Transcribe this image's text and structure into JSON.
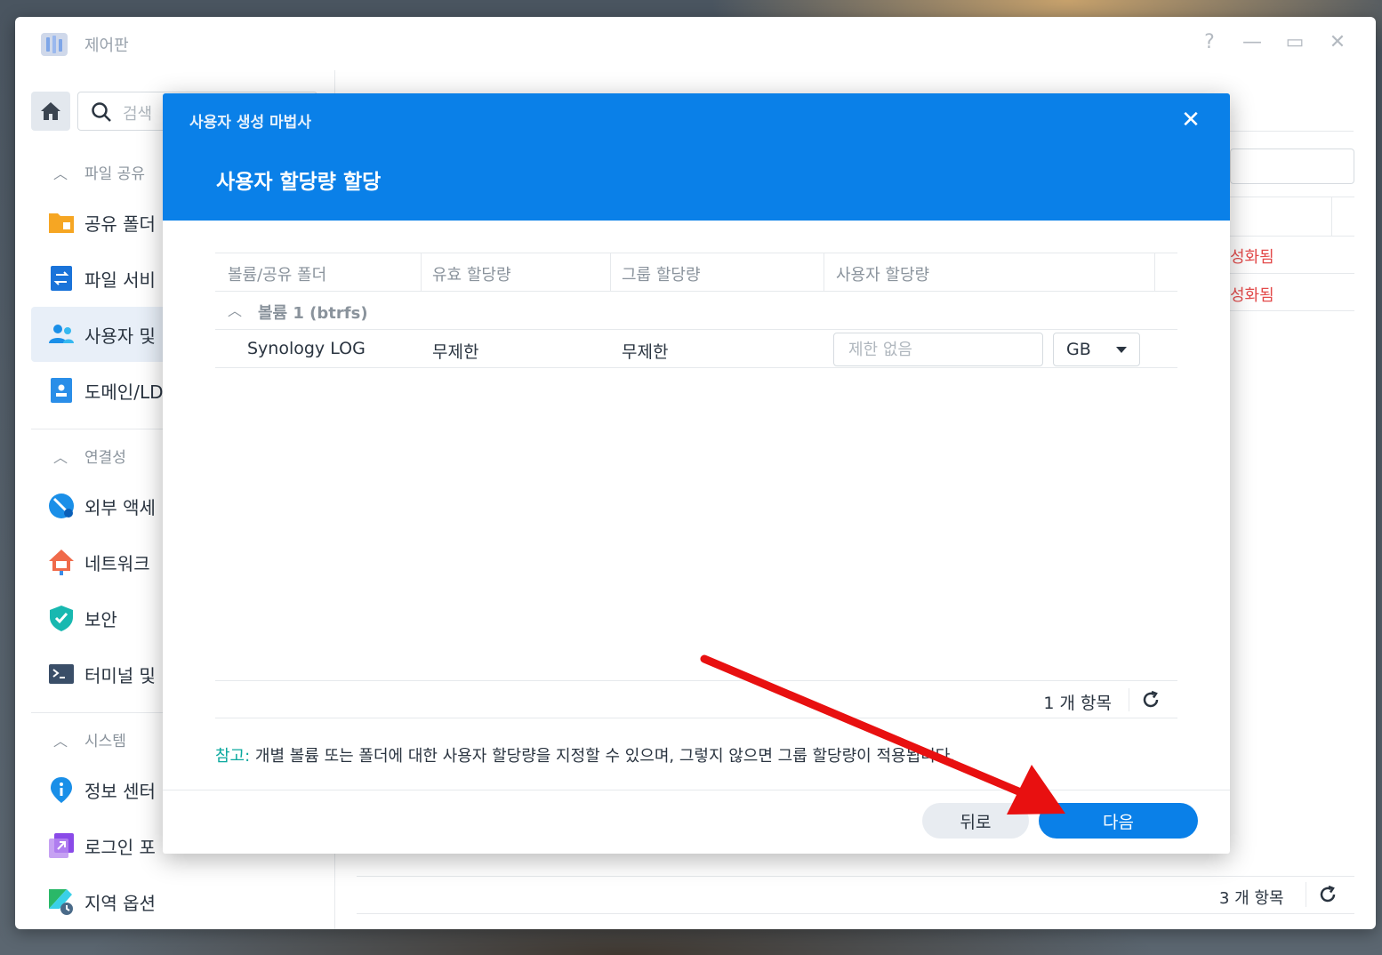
{
  "window": {
    "title": "제어판",
    "controls": [
      "?",
      "—",
      "▭",
      "✕"
    ]
  },
  "sidebar": {
    "search_placeholder": "검색",
    "sections": [
      {
        "label": "파일 공유",
        "items": [
          "공유 폴더",
          "파일 서비스",
          "사용자 및 그룹",
          "도메인/LDAP"
        ]
      },
      {
        "label": "연결성",
        "items": [
          "외부 액세스",
          "네트워크",
          "보안",
          "터미널 및 SNMP"
        ]
      },
      {
        "label": "시스템",
        "items": [
          "정보 센터",
          "로그인 포털",
          "지역 옵션"
        ]
      }
    ],
    "visible_labels": {
      "shared_folder": "공유 폴더",
      "file_services": "파일 서비",
      "user_group": "사용자 및",
      "domain": "도메인/LD",
      "external_access": "외부 액세",
      "network": "네트워크",
      "security": "보안",
      "terminal": "터미널 및",
      "info_center": "정보 센터",
      "login_portal": "로그인 포",
      "regional": "지역 옵션"
    },
    "section_labels": {
      "file_sharing": "파일 공유",
      "connectivity": "연결성",
      "system": "시스템"
    }
  },
  "background": {
    "status_1": "성화됨",
    "status_2": "성화됨",
    "count": "3 개 항목"
  },
  "dialog": {
    "wizard_title": "사용자 생성 마법사",
    "step_title": "사용자 할당량 할당",
    "columns": [
      "볼륨/공유 폴더",
      "유효 할당량",
      "그룹 할당량",
      "사용자 할당량"
    ],
    "group": "볼륨 1 (btrfs)",
    "row": {
      "folder": "Synology LOG",
      "effective_quota": "무제한",
      "group_quota": "무제한",
      "user_quota_placeholder": "제한 없음",
      "unit": "GB"
    },
    "count": "1 개 항목",
    "note_label": "참고:",
    "note_text": " 개별 볼륨 또는 폴더에 대한 사용자 할당량을 지정할 수 있으며, 그렇지 않으면 그룹 할당량이 적용됩니다.",
    "back_label": "뒤로",
    "next_label": "다음"
  },
  "colors": {
    "accent": "#0a80e8",
    "note_accent": "#0aa89e",
    "annotation_arrow": "#e81010",
    "status_red": "#e34b4b"
  }
}
